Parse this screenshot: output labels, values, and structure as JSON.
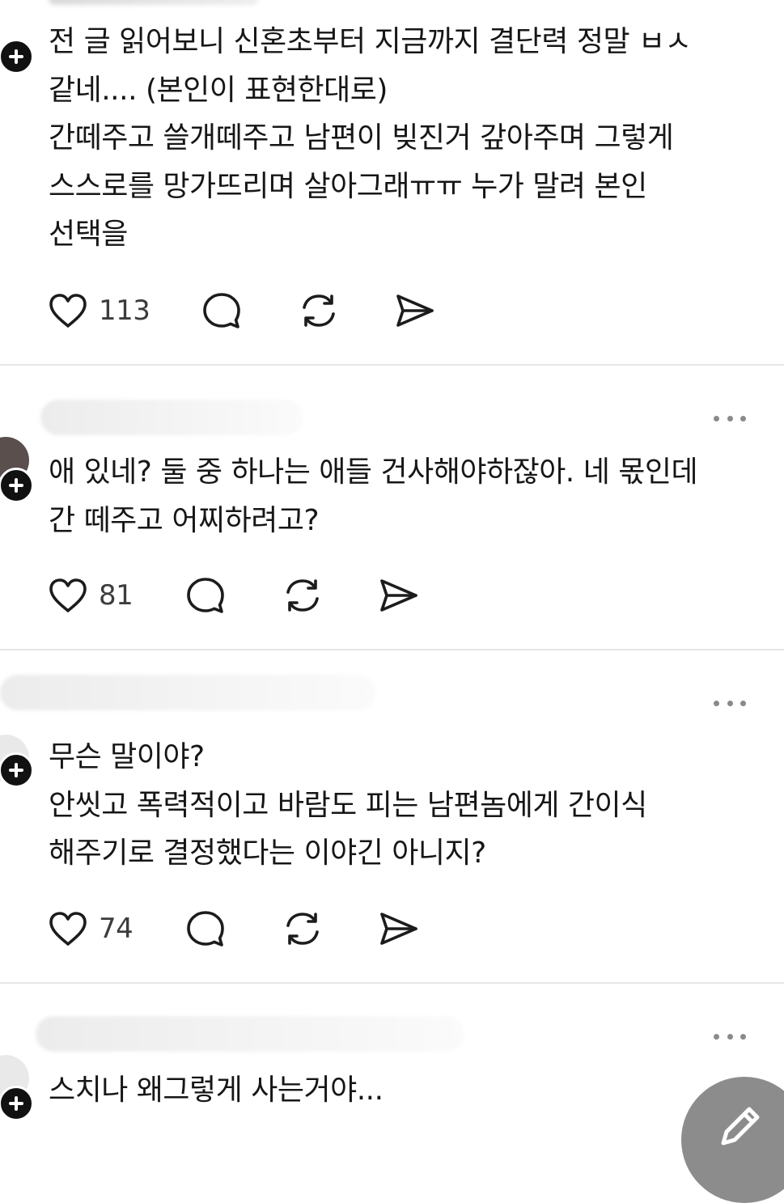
{
  "colors": {
    "text": "#161616",
    "muted": "#3c3c3c",
    "divider": "#e6e6e6",
    "fab": "#8c8c8c"
  },
  "icons": {
    "like": "heart-icon",
    "reply": "comment-bubble-icon",
    "repost": "repost-icon",
    "share": "send-icon",
    "more": "more-horizontal-icon",
    "follow": "plus-icon",
    "compose": "pencil-icon"
  },
  "posts": [
    {
      "lines": [
        "전 글 읽어보니 신혼초부터 지금까지 결단력 정말 ㅂㅅ",
        "같네.... (본인이 표현한대로)",
        "간떼주고 쓸개떼주고 남편이 빚진거 갚아주며 그렇게",
        "스스로를 망가뜨리며 살아그래ㅠㅠ 누가 말려 본인",
        "선택을"
      ],
      "likes": "113"
    },
    {
      "lines": [
        "애 있네? 둘 중 하나는 애들 건사해야하잖아. 네 몫인데",
        "간 떼주고 어찌하려고?"
      ],
      "likes": "81"
    },
    {
      "lines": [
        "무슨 말이야?",
        "안씻고 폭력적이고 바람도 피는 남편놈에게 간이식",
        "해주기로 결정했다는 이야긴 아니지?"
      ],
      "likes": "74"
    },
    {
      "lines": [
        "스치나 왜그렇게 사는거야..."
      ]
    }
  ]
}
